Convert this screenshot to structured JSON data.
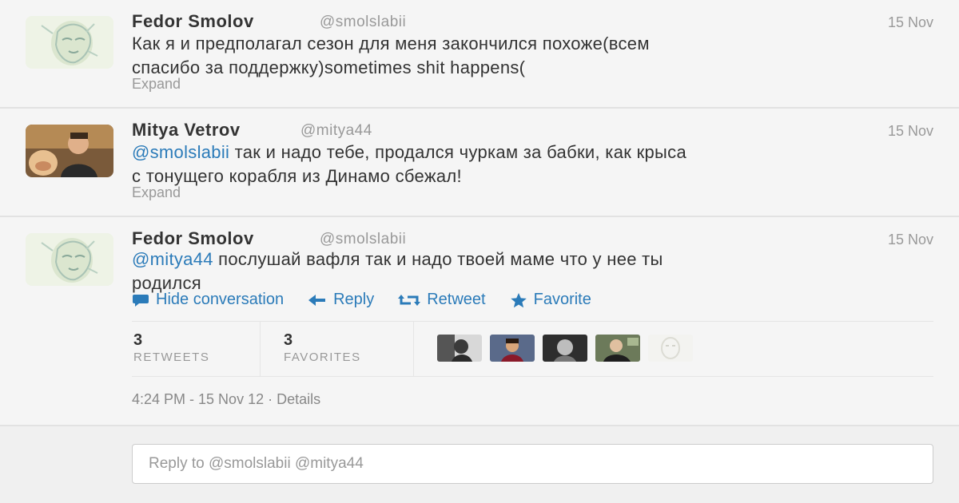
{
  "tweets": [
    {
      "name": "Fedor Smolov",
      "handle": "@smolslabii",
      "date": "15 Nov",
      "text_lines": [
        "Как я и предполагал сезон для меня закончился похоже(всем",
        "спасибо за поддержку)sometimes shit happens("
      ],
      "expand": "Expand",
      "avatar": "sketch-face-avatar"
    },
    {
      "name": "Mitya Vetrov",
      "handle": "@mitya44",
      "date": "15 Nov",
      "mention": "@smolslabii",
      "text_line1_rest": " так и надо тебе, продался чуркам за бабки, как крыса",
      "text_line2": "с тонущего корабля из Динамо сбежал!",
      "expand": "Expand",
      "avatar": "photo-avatar"
    },
    {
      "name": "Fedor Smolov",
      "handle": "@smolslabii",
      "date": "15 Nov",
      "mention": "@mitya44",
      "text_line1_rest": " послушай вафля так и надо твоей маме что у нее ты",
      "text_line2": "родился",
      "avatar": "sketch-face-avatar"
    }
  ],
  "actions": {
    "hide": "Hide conversation",
    "reply": "Reply",
    "retweet": "Retweet",
    "favorite": "Favorite"
  },
  "stats": {
    "retweets_count": "3",
    "retweets_label": "RETWEETS",
    "favorites_count": "3",
    "favorites_label": "FAVORITES"
  },
  "timestamp": {
    "time": "4:24 PM - 15 Nov 12",
    "separator": " · ",
    "details": "Details"
  },
  "reply_box": {
    "placeholder": "Reply to @smolslabii @mitya44"
  },
  "colors": {
    "link": "#2b7bb9",
    "muted": "#999999",
    "text": "#333333",
    "background": "#f5f5f5"
  }
}
